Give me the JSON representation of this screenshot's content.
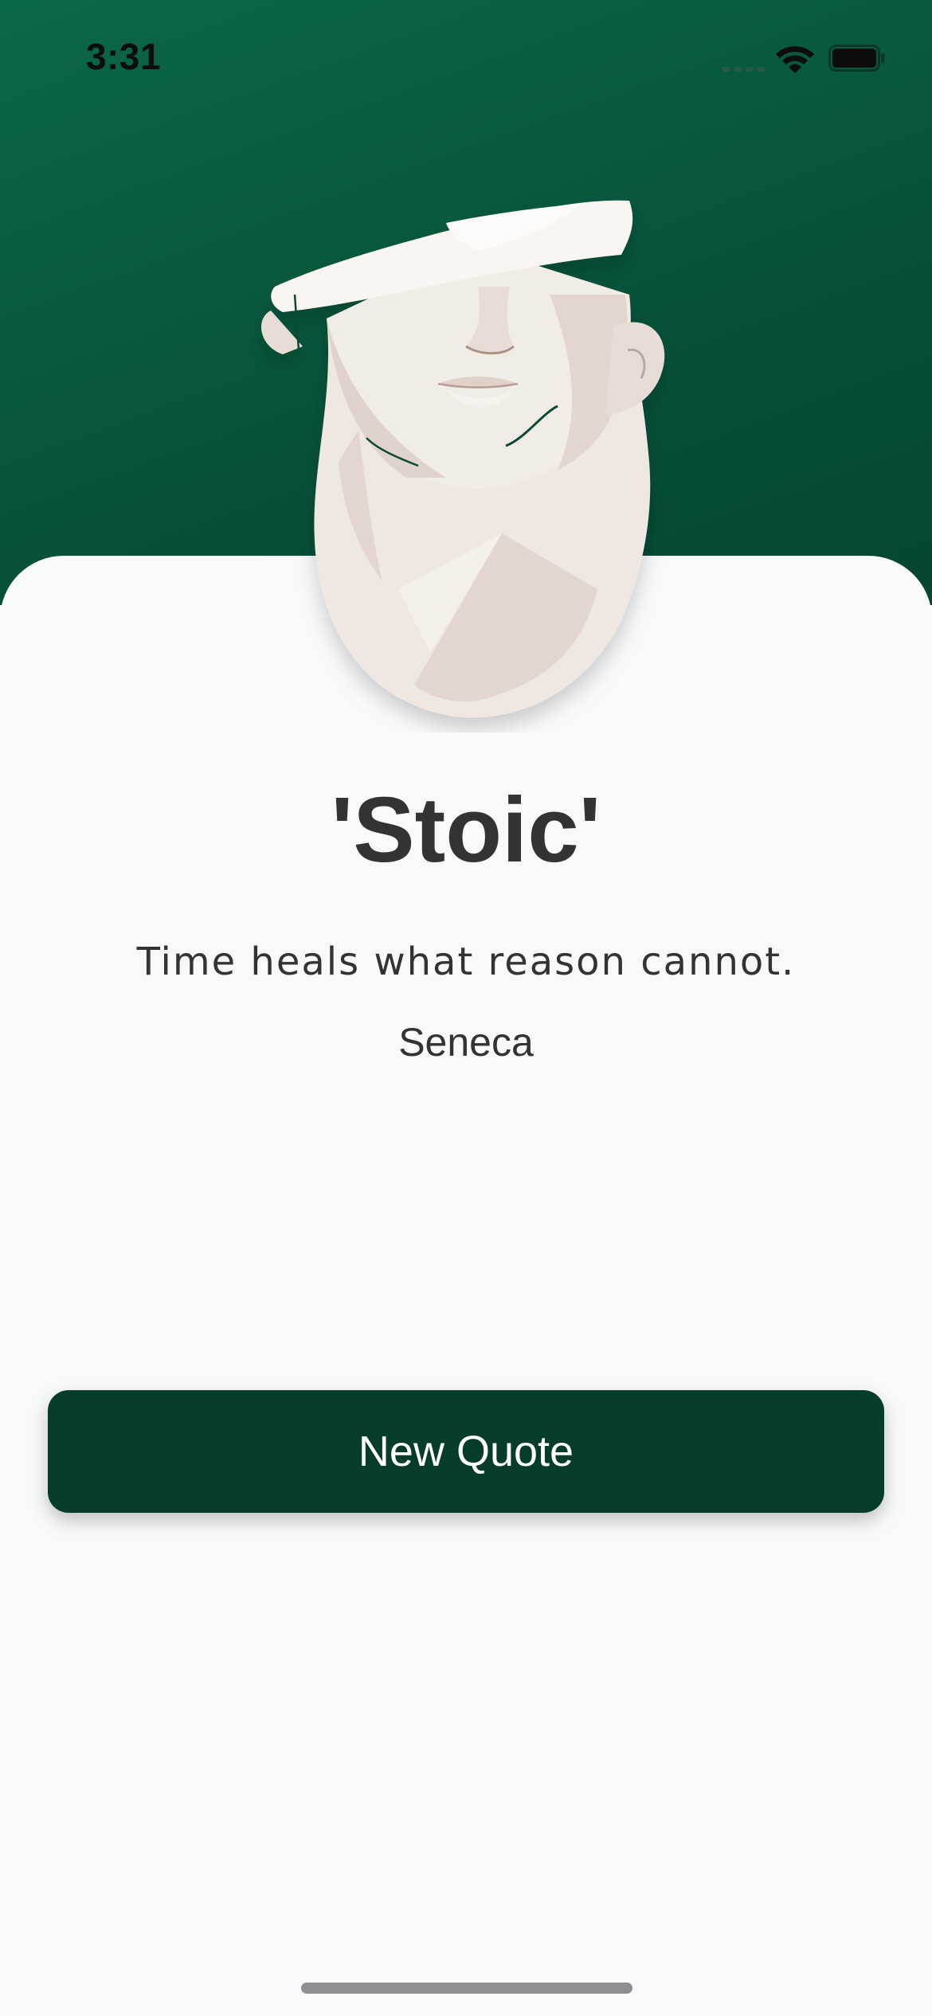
{
  "status_bar": {
    "time": "3:31",
    "icons": [
      "cellular-signal-icon",
      "wifi-icon",
      "battery-icon"
    ]
  },
  "hero": {
    "illustration": "stoic-bust-icon",
    "colors": {
      "background_start": "#0b6847",
      "background_end": "#06452f"
    }
  },
  "content": {
    "title": "'Stoic'",
    "quote": "Time heals what reason cannot.",
    "author": "Seneca"
  },
  "actions": {
    "new_quote_label": "New Quote",
    "button_color": "#053d2a"
  },
  "colors": {
    "card_background": "#f8f9fb",
    "text": "#333333"
  }
}
